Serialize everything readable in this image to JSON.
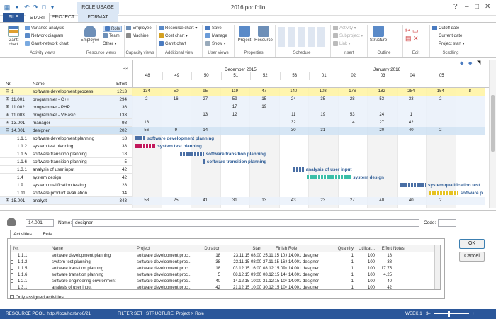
{
  "window": {
    "title": "2016 portfolio",
    "context_group": "ROLE USAGE"
  },
  "tabs": [
    {
      "label": "FILE"
    },
    {
      "label": "START"
    },
    {
      "label": "PROJECT"
    },
    {
      "label": "FORMAT"
    }
  ],
  "ribbon": {
    "gantt_chart": "Gantt chart",
    "variance_analysis": "Variance analysis",
    "network_diagram": "Network diagram",
    "gantt_network_chart": "Gantt-network chart",
    "employee": "Employee",
    "role": "Role",
    "team": "Team",
    "other": "Other",
    "employee2": "Employee",
    "machine": "Machine",
    "resource_chart": "Resource chart",
    "cost_chart": "Cost chart",
    "gantt_chart2": "Gantt chart",
    "save": "Save",
    "manage": "Manage",
    "show": "Show",
    "project": "Project",
    "resource": "Resource",
    "activity": "Activity",
    "subproject": "Subproject",
    "link": "Link",
    "structure": "Structure",
    "cutoff_date": "Cutoff date",
    "current_date": "Current date",
    "project_start": "Project start",
    "groups": {
      "activity_views": "Activity views",
      "resource_views": "Resource views",
      "capacity_views": "Capacity views",
      "additional_view": "Additional view",
      "user_views": "User views",
      "properties": "Properties",
      "schedule": "Schedule",
      "insert": "Insert",
      "outline": "Outline",
      "edit": "Edit",
      "scrolling": "Scrolling"
    }
  },
  "grid": {
    "col_nr": "Nr.",
    "col_name": "Name",
    "col_effort": "Effort",
    "collapse": "<<",
    "months": {
      "m1": "December 2015",
      "m2": "January 2016"
    },
    "weeks": [
      "48",
      "49",
      "50",
      "51",
      "52",
      "53",
      "01",
      "02",
      "03",
      "04",
      "05"
    ],
    "rows": [
      {
        "nr": "1",
        "name": "software development process",
        "effort": "1213",
        "vals": [
          "134",
          "50",
          "95",
          "119",
          "47",
          "140",
          "108",
          "176",
          "182",
          "284",
          "154",
          "8"
        ]
      },
      {
        "nr": "11.001",
        "name": "programmer - C++",
        "effort": "294",
        "vals": [
          "2",
          "16",
          "27",
          "59",
          "15",
          "24",
          "35",
          "28",
          "53",
          "33",
          "2",
          ""
        ]
      },
      {
        "nr": "11.002",
        "name": "programmer - PHP",
        "effort": "36",
        "vals": [
          "",
          "",
          "",
          "17",
          "19",
          "",
          "",
          "",
          "",
          "",
          "",
          ""
        ]
      },
      {
        "nr": "11.003",
        "name": "programmer - V.Basic",
        "effort": "133",
        "vals": [
          "",
          "",
          "13",
          "12",
          "",
          "11",
          "19",
          "53",
          "24",
          "1",
          "",
          ""
        ]
      },
      {
        "nr": "13.001",
        "name": "manager",
        "effort": "98",
        "vals": [
          "18",
          "",
          "",
          "",
          "",
          "32",
          "",
          "14",
          "27",
          "42",
          "",
          ""
        ]
      },
      {
        "nr": "14.001",
        "name": "designer",
        "effort": "202",
        "vals": [
          "56",
          "9",
          "14",
          "",
          "",
          "30",
          "31",
          "",
          "20",
          "40",
          "2",
          ""
        ]
      },
      {
        "nr": "1.1.1",
        "name": "software development planning",
        "effort": "18",
        "bar": "software development planning"
      },
      {
        "nr": "1.1.2",
        "name": "system test planning",
        "effort": "38",
        "bar": "system test planning"
      },
      {
        "nr": "1.1.5",
        "name": "software transition planning",
        "effort": "18",
        "bar": "software transition planning"
      },
      {
        "nr": "1.1.6",
        "name": "software transition planning",
        "effort": "5",
        "bar": "software transition planning"
      },
      {
        "nr": "1.3.1",
        "name": "analysis of user input",
        "effort": "42",
        "bar": "analysis of user input"
      },
      {
        "nr": "1.4",
        "name": "system design",
        "effort": "42",
        "bar": "system design"
      },
      {
        "nr": "1.9",
        "name": "system qualification testing",
        "effort": "28",
        "bar": "system qualification test"
      },
      {
        "nr": "1.11",
        "name": "software product evaluation",
        "effort": "34",
        "bar": "software p"
      },
      {
        "nr": "15.001",
        "name": "analyst",
        "effort": "343",
        "vals": [
          "58",
          "25",
          "41",
          "31",
          "13",
          "43",
          "23",
          "27",
          "40",
          "40",
          "2",
          ""
        ]
      }
    ]
  },
  "details": {
    "id": "14.001",
    "name_label": "Name:",
    "name_value": "designer",
    "code_label": "Code:",
    "code_value": "",
    "tab_activities": "Activities",
    "tab_role": "Role",
    "ok": "OK",
    "cancel": "Cancel",
    "only_assigned": "Only assigned activities",
    "columns": [
      "Nr.",
      "Name",
      "Project",
      "Duration",
      "Start",
      "Finish",
      "Role",
      "Quantity",
      "Utilizat...",
      "Effort",
      "Notes"
    ],
    "rows": [
      [
        "1.1.1",
        "software development planning",
        "software development proc...",
        "18",
        "23.11.15 08:00",
        "25.11.15 10:00",
        "14.001 designer",
        "1",
        "100",
        "18",
        ""
      ],
      [
        "1.1.2",
        "system test planning",
        "software development proc...",
        "38",
        "23.11.15 08:00",
        "27.11.15 16:00",
        "14.001 designer",
        "1",
        "100",
        "38",
        ""
      ],
      [
        "1.1.5",
        "software transition planning",
        "software development proc...",
        "18",
        "03.12.15 16:00",
        "08.12.15 09:00",
        "14.001 designer",
        "1",
        "100",
        "17.75",
        ""
      ],
      [
        "1.1.6",
        "software transition planning",
        "software development proc...",
        "5",
        "08.12.15 09:00",
        "08.12.15 14:00",
        "14.001 designer",
        "1",
        "100",
        "4.25",
        ""
      ],
      [
        "1.2.1",
        "software engineering environment",
        "software development proc...",
        "40",
        "14.12.15 10:00",
        "21.12.15 10:00",
        "14.001 designer",
        "1",
        "100",
        "40",
        ""
      ],
      [
        "1.3.1",
        "analysis of user input",
        "software development proc...",
        "42",
        "21.12.15 10:00",
        "30.12.15 10:00",
        "14.001 designer",
        "1",
        "100",
        "42",
        ""
      ]
    ]
  },
  "status": {
    "pool": "RESOURCE POOL: http://localhost/rio6/21",
    "filter": "FILTER SET",
    "structure": "STRUCTURE: Project > Role",
    "week": "WEEK 1 : 3"
  }
}
